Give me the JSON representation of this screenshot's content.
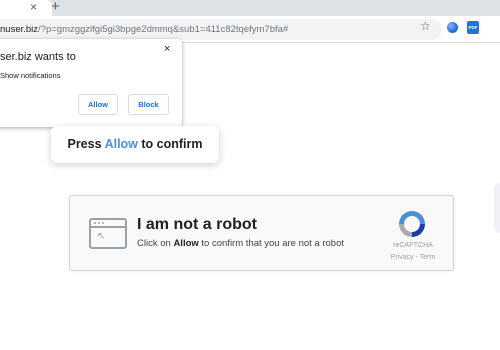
{
  "browser": {
    "tab_close_glyph": "×",
    "new_tab_glyph": "+",
    "url_host": "nuser.biz",
    "url_path": "/?p=gmzggzlfgi5gi3bpge2dmmq&sub1=411c82tqefym7bfa#",
    "star_glyph": "☆",
    "pdf_label": "PDF"
  },
  "permission_popup": {
    "title": "ser.biz wants to",
    "permission": "Show notifications",
    "close_glyph": "×",
    "allow_label": "Allow",
    "block_label": "Block"
  },
  "prompt": {
    "prefix": "Press ",
    "highlight": "Allow",
    "suffix": " to confirm"
  },
  "captcha": {
    "title": "I am not a robot",
    "sub_prefix": "Click on ",
    "sub_bold": "Allow",
    "sub_suffix": " to confirm that you are not a robot",
    "brand": "reCAPTCHA",
    "links": "Privacy - Term"
  },
  "colors": {
    "accent": "#4a90d9",
    "link_blue": "#1a73e8"
  }
}
